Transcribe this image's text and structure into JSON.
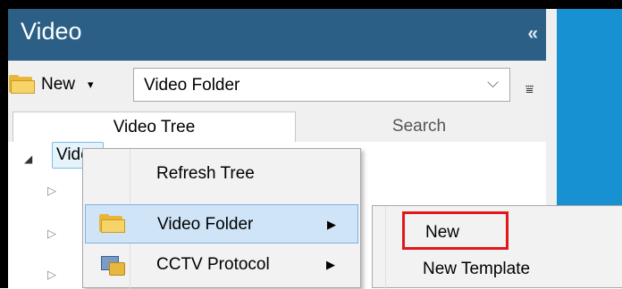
{
  "panel": {
    "title": "Video",
    "collapse_glyph": "«"
  },
  "toolbar": {
    "new_label": "New",
    "new_dropdown_glyph": "▾",
    "combo_value": "Video Folder",
    "combo_chevron": "⌵",
    "overflow_glyph": "⩸"
  },
  "tabs": [
    {
      "label": "Video Tree",
      "active": true
    },
    {
      "label": "Search",
      "active": false
    }
  ],
  "tree": {
    "root_label": "Video",
    "root_expand_glyph": "◢",
    "child_expand_glyph": "▷"
  },
  "context_menu": {
    "items": [
      {
        "label": "Refresh Tree",
        "icon": "none",
        "has_submenu": false
      },
      {
        "label": "Video Folder",
        "icon": "folder-icon",
        "has_submenu": true,
        "highlighted": true
      },
      {
        "label": "CCTV Protocol",
        "icon": "cctv-protocol-icon",
        "has_submenu": true
      }
    ],
    "submenu_arrow": "▶"
  },
  "submenu": {
    "items": [
      {
        "label": "New",
        "emphasized_box_color": "#e3161c"
      },
      {
        "label": "New Template"
      }
    ]
  },
  "colors": {
    "titlebar": "#2b5f86",
    "accent_blue": "#1791d2",
    "highlight": "#cfe4f7",
    "emphasis_red": "#e3161c"
  }
}
